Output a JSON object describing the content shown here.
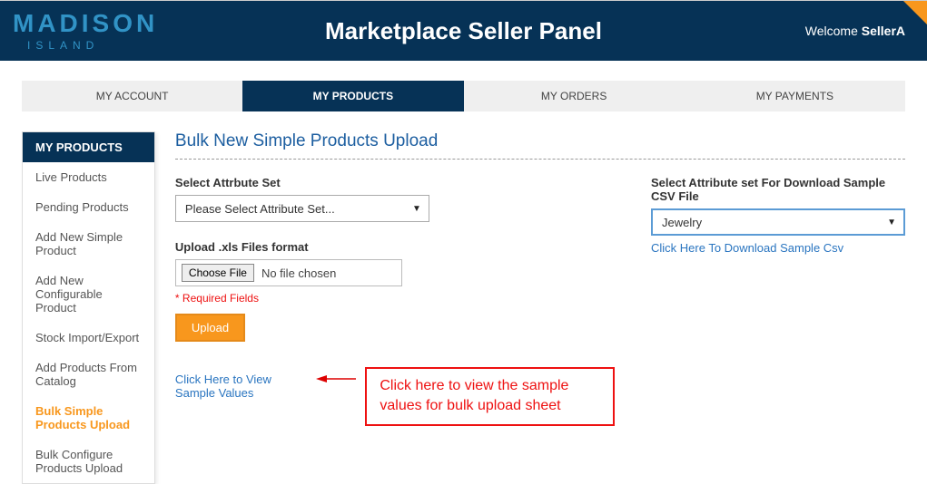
{
  "header": {
    "logo_main": "MADISON",
    "logo_sub": "ISLAND",
    "title": "Marketplace Seller Panel",
    "welcome_prefix": "Welcome ",
    "welcome_user": "SellerA"
  },
  "tabs": [
    {
      "label": "MY ACCOUNT",
      "active": false
    },
    {
      "label": "MY PRODUCTS",
      "active": true
    },
    {
      "label": "MY ORDERS",
      "active": false
    },
    {
      "label": "MY PAYMENTS",
      "active": false
    }
  ],
  "sidebar": {
    "header": "MY PRODUCTS",
    "items": [
      {
        "label": "Live Products",
        "active": false
      },
      {
        "label": "Pending Products",
        "active": false
      },
      {
        "label": "Add New Simple Product",
        "active": false
      },
      {
        "label": "Add New Configurable Product",
        "active": false
      },
      {
        "label": "Stock Import/Export",
        "active": false
      },
      {
        "label": "Add Products From Catalog",
        "active": false
      },
      {
        "label": "Bulk Simple Products Upload",
        "active": true
      },
      {
        "label": "Bulk Configure Products Upload",
        "active": false
      }
    ]
  },
  "main": {
    "page_title": "Bulk New Simple Products Upload",
    "attr_set_label": "Select Attrbute Set",
    "attr_set_value": "Please Select Attribute Set...",
    "sample_csv_label": "Select Attribute set For Download Sample CSV File",
    "sample_csv_value": "Jewelry",
    "sample_csv_link": "Click Here To Download Sample Csv",
    "upload_label": "Upload .xls Files format",
    "choose_label": "Choose File",
    "file_status": "No file chosen",
    "required_text": "* Required Fields",
    "upload_button": "Upload",
    "view_sample_link": "Click Here to View Sample Values"
  },
  "annotation": {
    "text": "Click here to view the sample values for bulk upload sheet"
  }
}
